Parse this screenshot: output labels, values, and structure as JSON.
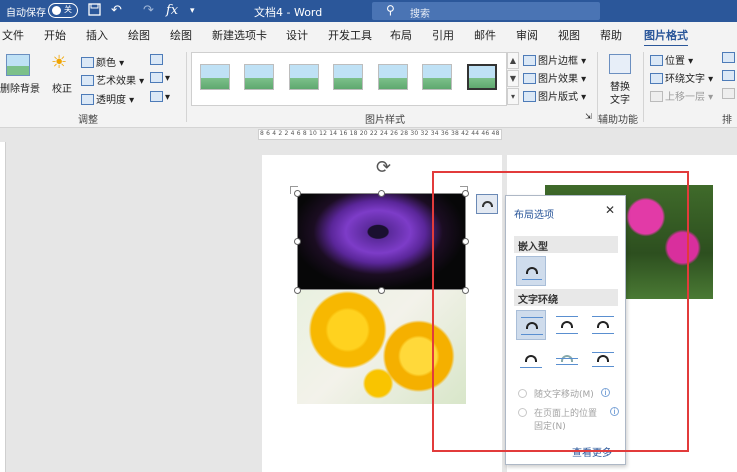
{
  "titlebar": {
    "autosave_label": "自动保存",
    "toggle_state": "关",
    "undo_glyph": "↶",
    "redo_glyph": "↷",
    "fx_glyph": "fx",
    "doc_title": "文档4 - Word",
    "search_placeholder": "搜索",
    "bg_color": "#2b579a"
  },
  "tabs": [
    "文件",
    "开始",
    "插入",
    "绘图",
    "绘图",
    "新建选项卡",
    "设计",
    "开发工具",
    "布局",
    "引用",
    "邮件",
    "审阅",
    "视图",
    "帮助",
    "图片格式"
  ],
  "active_tab": "图片格式",
  "ribbon": {
    "remove_bg": "删除背景",
    "correct": "校正",
    "color": "颜色",
    "artistic": "艺术效果",
    "transparency": "透明度",
    "adjust_group": "调整",
    "styles_group": "图片样式",
    "picture_border": "图片边框",
    "picture_effects": "图片效果",
    "picture_layout": "图片版式",
    "alt_text_line1": "替换",
    "alt_text_line2": "文字",
    "accessibility_group": "辅助功能",
    "position": "位置",
    "wrap_text": "环绕文字",
    "bring_forward": "上移一层",
    "arrange_group": "排列"
  },
  "ruler": {
    "numbers": "8 6 4 2    2  4  6  8  10 12 14 16 18 20 22 24 26 28 30 32 34 36 38    42 44 46 48"
  },
  "layout_panel": {
    "title": "布局选项",
    "close": "✕",
    "inline_section": "嵌入型",
    "wrap_section": "文字环绕",
    "move_with_text": "随文字移动(M)",
    "fix_position_line1": "在页面上的位置",
    "fix_position_line2": "固定(N)",
    "see_more": "查看更多",
    "info": "i"
  },
  "colors": {
    "accent": "#2b579a",
    "highlight_box": "#e23b3b"
  }
}
